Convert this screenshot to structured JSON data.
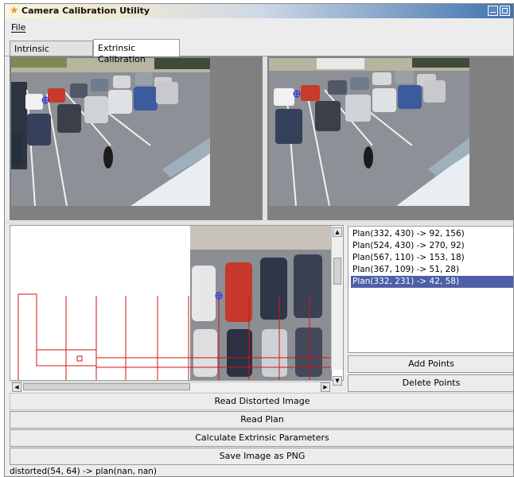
{
  "window": {
    "title": "Camera Calibration Utility",
    "colors": {
      "title_gradient_start": "#fbf4e4",
      "title_gradient_end": "#3e72ae",
      "selection": "#4e5ea8"
    }
  },
  "menu": {
    "file": "File"
  },
  "tabs": [
    {
      "label": "Intrinsic Calibration",
      "active": false
    },
    {
      "label": "Extrinsic Calibration",
      "active": true
    }
  ],
  "images": {
    "left": {
      "description_icon": "camera-image-icon"
    },
    "right": {
      "description_icon": "camera-image-icon"
    }
  },
  "point_list": {
    "items": [
      "Plan(332, 430) ->  92, 156)",
      "Plan(524, 430) ->  270, 92)",
      "Plan(567, 110) ->  153, 18)",
      "Plan(367, 109) ->  51, 28)",
      "Plan(332, 231) ->  42, 58)"
    ],
    "selected_index": 4
  },
  "buttons": {
    "add_points": "Add Points",
    "delete_points": "Delete Points",
    "read_distorted": "Read Distorted Image",
    "read_plan": "Read Plan",
    "calculate": "Calculate Extrinsic Parameters",
    "save_png": "Save Image as PNG"
  },
  "status": "distorted(54, 64) -> plan(nan, nan)"
}
